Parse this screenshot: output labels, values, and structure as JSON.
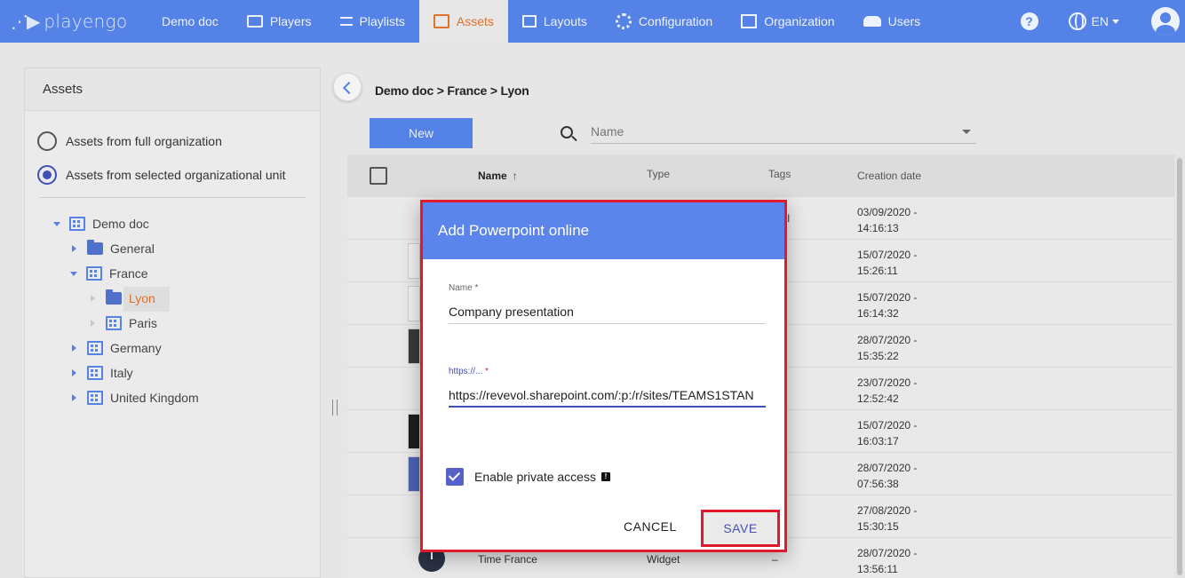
{
  "topbar": {
    "brand": "playengo",
    "nav": [
      {
        "label": "Demo doc"
      },
      {
        "label": "Players"
      },
      {
        "label": "Playlists"
      },
      {
        "label": "Assets"
      },
      {
        "label": "Layouts"
      },
      {
        "label": "Configuration"
      },
      {
        "label": "Organization"
      },
      {
        "label": "Users"
      }
    ],
    "language": "EN",
    "active_color": "#e0702a",
    "bar_color": "#5582e6"
  },
  "left": {
    "title": "Assets",
    "radio_full": "Assets from full organization",
    "radio_selected": "Assets from selected organizational unit",
    "tree": {
      "root": "Demo doc",
      "general": "General",
      "france": "France",
      "lyon": "Lyon",
      "paris": "Paris",
      "germany": "Germany",
      "italy": "Italy",
      "uk": "United Kingdom"
    }
  },
  "main": {
    "breadcrumb": "Demo doc > France > Lyon",
    "new_label": "New",
    "search_placeholder": "Name",
    "columns": {
      "name": "Name",
      "type": "Type",
      "tags": "Tags",
      "date": "Creation date"
    },
    "rows": [
      {
        "tags": "rnal",
        "date1": "03/09/2020 -",
        "date2": "14:16:13"
      },
      {
        "date1": "15/07/2020 -",
        "date2": "15:26:11"
      },
      {
        "date1": "15/07/2020 -",
        "date2": "16:14:32"
      },
      {
        "date1": "28/07/2020 -",
        "date2": "15:35:22"
      },
      {
        "date1": "23/07/2020 -",
        "date2": "12:52:42"
      },
      {
        "date1": "15/07/2020 -",
        "date2": "16:03:17"
      },
      {
        "date1": "28/07/2020 -",
        "date2": "07:56:38"
      },
      {
        "date1": "27/08/2020 -",
        "date2": "15:30:15"
      },
      {
        "name": "Time France",
        "type": "Widget",
        "tags": "–",
        "date1": "28/07/2020 -",
        "date2": "13:56:11"
      }
    ]
  },
  "dialog": {
    "title": "Add Powerpoint online",
    "name_label": "Name",
    "name_value": "Company presentation",
    "url_label": "https://...",
    "url_value": "https://revevol.sharepoint.com/:p:/r/sites/TEAMS1STAN",
    "required_mark": "*",
    "private_label": "Enable private access",
    "cancel": "CANCEL",
    "save": "SAVE",
    "header_color": "#5b85ea",
    "highlight_color": "#e01a2b"
  }
}
